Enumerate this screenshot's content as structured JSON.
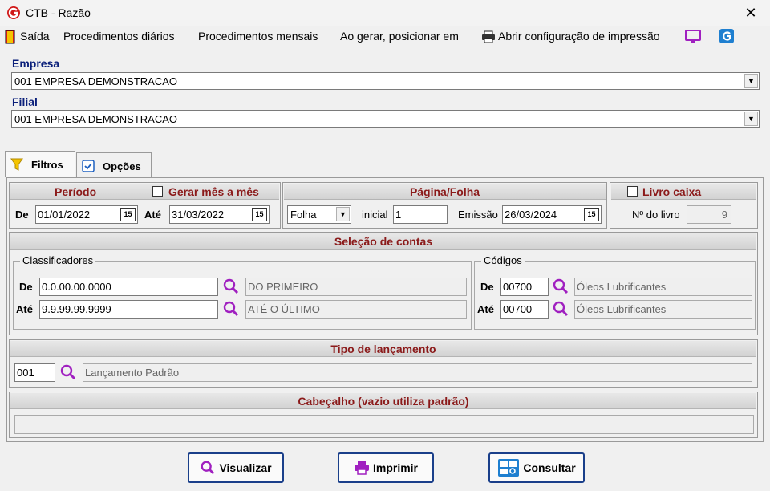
{
  "window": {
    "title": "CTB - Razão"
  },
  "menu": {
    "items": [
      "Saída",
      "Procedimentos diários",
      "Procedimentos mensais",
      "Ao gerar, posicionar em",
      "Abrir configuração de impressão"
    ]
  },
  "empresa": {
    "label": "Empresa",
    "value": "001 EMPRESA DEMONSTRACAO"
  },
  "filial": {
    "label": "Filial",
    "value": "001 EMPRESA DEMONSTRACAO"
  },
  "tabs": [
    {
      "label": "Filtros"
    },
    {
      "label": "Opções"
    }
  ],
  "periodo": {
    "title": "Período",
    "gerar_label": "Gerar mês a mês",
    "gerar_checked": false,
    "de_label": "De",
    "de_value": "01/01/2022",
    "ate_label": "Até",
    "ate_value": "31/03/2022"
  },
  "pagina": {
    "title": "Página/Folha",
    "tipo": "Folha",
    "inicial_label": "inicial",
    "inicial_value": "1",
    "emissao_label": "Emissão",
    "emissao_value": "26/03/2024"
  },
  "livro": {
    "title": "Livro caixa",
    "checked": false,
    "num_label": "Nº do livro",
    "num_value": "9"
  },
  "selecao": {
    "title": "Seleção de contas",
    "classificadores": {
      "legend": "Classificadores",
      "de_label": "De",
      "de_value": "0.0.00.00.0000",
      "de_desc": "DO PRIMEIRO",
      "ate_label": "Até",
      "ate_value": "9.9.99.99.9999",
      "ate_desc": "ATÉ O ÚLTIMO"
    },
    "codigos": {
      "legend": "Códigos",
      "de_label": "De",
      "de_value": "00700",
      "de_desc": "Óleos Lubrificantes",
      "ate_label": "Até",
      "ate_value": "00700",
      "ate_desc": "Óleos Lubrificantes"
    }
  },
  "tipo_lancamento": {
    "title": "Tipo de lançamento",
    "code": "001",
    "desc": "Lançamento Padrão"
  },
  "cabecalho": {
    "title": "Cabeçalho (vazio utiliza padrão)",
    "value": ""
  },
  "buttons": {
    "visualizar": {
      "first": "V",
      "rest": "isualizar"
    },
    "imprimir": {
      "first": "I",
      "rest": "mprimir"
    },
    "consultar": {
      "first": "C",
      "rest": "onsultar"
    }
  },
  "colors": {
    "header_text": "#8b1a1a",
    "label_blue": "#0a1f7a",
    "button_border": "#1a3f8a",
    "icon_purple": "#a020c0",
    "icon_blue": "#1e7fd0"
  }
}
